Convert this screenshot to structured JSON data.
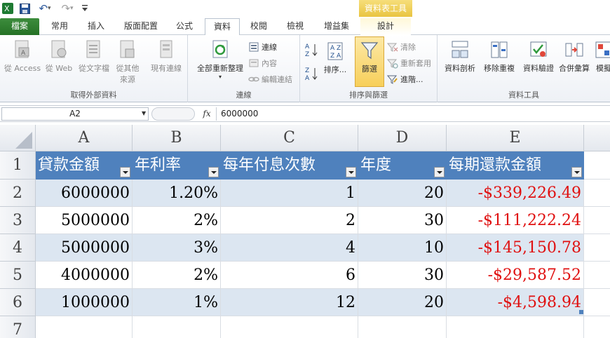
{
  "qat": {
    "undo": "↶",
    "redo": "↷",
    "customize": "▾"
  },
  "contextual_group": "資料表工具",
  "tabs": [
    "檔案",
    "常用",
    "插入",
    "版面配置",
    "公式",
    "資料",
    "校閱",
    "檢視",
    "增益集",
    "設計"
  ],
  "ribbon": {
    "get_external": {
      "label": "取得外部資料",
      "buttons": [
        "從 Access",
        "從 Web",
        "從文字檔",
        "從其他\n來源",
        "現有連線"
      ]
    },
    "connections": {
      "label": "連線",
      "refresh_all": "全部重新整理",
      "items": [
        "連線",
        "內容",
        "編輯連結"
      ]
    },
    "sort_filter": {
      "label": "排序與篩選",
      "sort": "排序...",
      "filter": "篩選",
      "items": [
        "清除",
        "重新套用",
        "進階..."
      ]
    },
    "data_tools": {
      "label": "資料工具",
      "buttons": [
        "資料剖析",
        "移除重複",
        "資料驗證",
        "合併彙算",
        "模擬"
      ]
    }
  },
  "formula_bar": {
    "name_box": "A2",
    "fx": "fx",
    "value": "6000000"
  },
  "columns": [
    "A",
    "B",
    "C",
    "D",
    "E"
  ],
  "rows": [
    "1",
    "2",
    "3",
    "4",
    "5",
    "6",
    "7"
  ],
  "table": {
    "headers": [
      "貸款金額",
      "年利率",
      "每年付息次數",
      "年度",
      "每期還款金額"
    ],
    "data": [
      [
        "6000000",
        "1.20%",
        "1",
        "20",
        "-$339,226.49"
      ],
      [
        "5000000",
        "2%",
        "2",
        "30",
        "-$111,222.24"
      ],
      [
        "5000000",
        "3%",
        "4",
        "10",
        "-$145,150.78"
      ],
      [
        "4000000",
        "2%",
        "6",
        "30",
        "-$29,587.52"
      ],
      [
        "1000000",
        "1%",
        "12",
        "20",
        "-$4,598.94"
      ]
    ]
  },
  "colors": {
    "table_header": "#4f81bd",
    "band": "#dce6f1",
    "negative": "#e01010",
    "file_tab": "#2e7d32"
  }
}
